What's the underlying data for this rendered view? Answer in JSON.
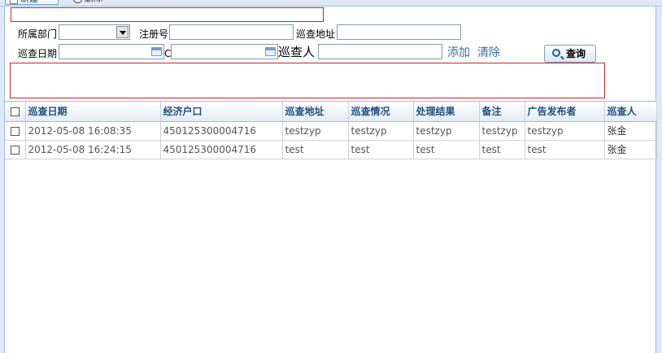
{
  "toolbar": {
    "new_label": "新建",
    "delete_label": "删除"
  },
  "form": {
    "dept_label": "所属部门",
    "dept_value": "",
    "reg_label": "注册号",
    "reg_value": "",
    "addr_label": "巡查地址",
    "addr_value": "",
    "date_label": "巡查日期",
    "date_from": "",
    "date_sep": "C",
    "date_to": "",
    "inspector_label": "巡查人",
    "inspector_value": "",
    "add_link": "添加",
    "clear_link": "清除",
    "search_button": "查询"
  },
  "grid": {
    "columns": [
      "巡查日期",
      "经济户口",
      "巡查地址",
      "巡查情况",
      "处理结果",
      "备注",
      "广告发布者",
      "巡查人"
    ],
    "rows": [
      [
        "2012-05-08 16:08:35",
        "450125300004716",
        "testzyp",
        "testzyp",
        "testzyp",
        "testzyp",
        "testzyp",
        "张金"
      ],
      [
        "2012-05-08 16:24:15",
        "450125300004716",
        "test",
        "test",
        "test",
        "test",
        "test",
        "张金"
      ]
    ]
  },
  "colors": {
    "accent": "#3a6ea5",
    "border": "#99bbe8",
    "error_box": "#cc2222",
    "header_text": "#1e4f83"
  }
}
